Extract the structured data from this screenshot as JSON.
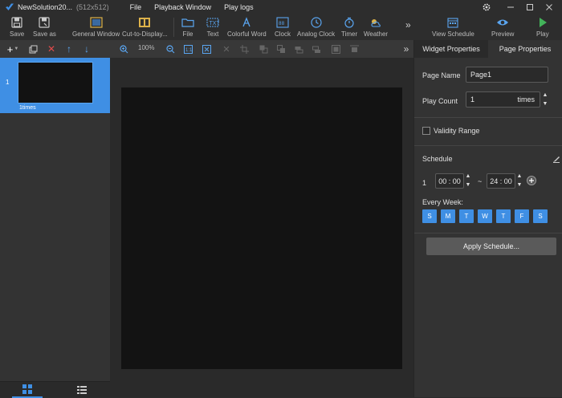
{
  "titlebar": {
    "app_name": "NewSolution20...",
    "resolution": "(512x512)",
    "menus": [
      "File",
      "Playback Window",
      "Play logs"
    ]
  },
  "toolbar": {
    "items": [
      {
        "label": "Save",
        "icon": "save-icon"
      },
      {
        "label": "Save as",
        "icon": "save-as-icon"
      },
      {
        "label": "General Window",
        "icon": "general-window-icon"
      },
      {
        "label": "Cut-to-Display...",
        "icon": "cut-to-display-icon"
      },
      {
        "label": "File",
        "icon": "file-folder-icon"
      },
      {
        "label": "Text",
        "icon": "text-icon"
      },
      {
        "label": "Colorful Word",
        "icon": "colorful-word-icon"
      },
      {
        "label": "Clock",
        "icon": "clock-icon"
      },
      {
        "label": "Analog Clock",
        "icon": "analog-clock-icon"
      },
      {
        "label": "Timer",
        "icon": "timer-icon"
      },
      {
        "label": "Weather",
        "icon": "weather-icon"
      },
      {
        "label": "View Schedule",
        "icon": "calendar-icon"
      },
      {
        "label": "Preview",
        "icon": "eye-icon"
      },
      {
        "label": "Play",
        "icon": "play-icon"
      }
    ]
  },
  "pages": {
    "items": [
      {
        "number": "1",
        "caption": "1times"
      }
    ]
  },
  "canvas_toolbar": {
    "zoom": "100%"
  },
  "properties": {
    "tabs": [
      "Widget Properties",
      "Page Properties"
    ],
    "active_tab": "Page Properties",
    "page_name_label": "Page Name",
    "page_name_value": "Page1",
    "play_count_label": "Play Count",
    "play_count_value": "1",
    "play_count_unit": "times",
    "validity_label": "Validity Range",
    "schedule_label": "Schedule",
    "schedule_index": "1",
    "start_time": "00 : 00",
    "end_time": "24 : 00",
    "range_sep": "~",
    "every_week_label": "Every Week:",
    "days": [
      "S",
      "M",
      "T",
      "W",
      "T",
      "F",
      "S"
    ],
    "apply_label": "Apply Schedule..."
  },
  "colors": {
    "accent": "#3f8fe4",
    "background": "#2b2b2b",
    "panel": "#333333",
    "stage": "#131313"
  }
}
